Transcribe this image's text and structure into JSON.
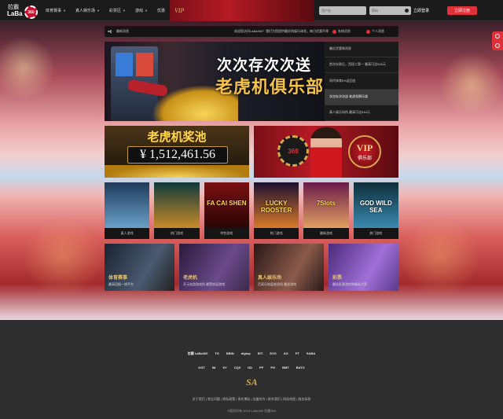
{
  "header": {
    "logo_text_top": "拉霸",
    "logo_text_bottom": "LaBa",
    "logo_badge": "360",
    "nav": [
      {
        "label": "体育赛事",
        "dropdown": true
      },
      {
        "label": "真人娱乐场",
        "dropdown": true
      },
      {
        "label": "彩票区",
        "dropdown": true
      },
      {
        "label": "游戏",
        "dropdown": true
      },
      {
        "label": "优惠",
        "dropdown": false
      }
    ],
    "vip_label": "VIP",
    "username_placeholder": "用户名",
    "password_placeholder": "密码",
    "login_label": "立即登录",
    "register_label": "立即注册"
  },
  "announcement": {
    "label": "最新消息",
    "text": "欢迎您访问LaBa360！我们为您提供最好的娱乐体验，每日优惠不停",
    "messages_label": "系统消息",
    "personal_label": "个人消息"
  },
  "hero": {
    "headline_1": "次次存次次送",
    "headline_2": "老虎机俱乐部"
  },
  "hero_menu": [
    {
      "label": "最近优惠和消息",
      "active": false
    },
    {
      "label": "首次存款后，西班二第一 最高可达518元",
      "active": false
    },
    {
      "label": "同代体育5%返回金",
      "active": false
    },
    {
      "label": "次次存次次送 老虎机俱乐部",
      "active": true
    },
    {
      "label": "真人娱乐场所 最高可达518元",
      "active": false
    }
  ],
  "promo": {
    "jackpot_title": "老虎机奖池",
    "jackpot_amount": "¥ 1,512,461.56",
    "vip_chip": "360",
    "vip_badge_top": "VIP",
    "vip_badge_bottom": "俱乐部"
  },
  "games": [
    {
      "label": "真人游戏",
      "art": ""
    },
    {
      "label": "热门游戏",
      "art": ""
    },
    {
      "label": "特色游戏",
      "art": "FA CAI SHEN"
    },
    {
      "label": "热门游戏",
      "art": "LUCKY ROOSTER"
    },
    {
      "label": "最新游戏",
      "art": "7Slots"
    },
    {
      "label": "热门游戏",
      "art": "GOD WILD SEA"
    }
  ],
  "cards": [
    {
      "title": "体育赛事",
      "subtitle": "最高回报一线平台"
    },
    {
      "title": "老虎机",
      "subtitle": "开元电游游戏机 最受欢迎游戏"
    },
    {
      "title": "真人娱乐场",
      "subtitle": "百家乐轮盘老虎机 最佳游戏"
    },
    {
      "title": "彩票",
      "subtitle": "最佳彩票游戏和精彩大奖"
    }
  ],
  "providers_row1": [
    "拉霸 LaBa360",
    "TG",
    "BBIN",
    "digtop",
    "BTI",
    "EVO",
    "AG",
    "PT",
    "SABA"
  ],
  "providers_row2": [
    "GGT",
    "IM",
    "SY",
    "CQ9",
    "GD",
    "PP",
    "PG",
    "BMT",
    "BATO"
  ],
  "providers_mark": "SA",
  "footer": {
    "links": "关于我们 | 常见问题 | 隐私政策 | 责任博彩 | 加盟合作 | 联系我们 | 网站地图 | 服务条款",
    "copyright": "©版权所有 2019 LaBa360 拉霸360"
  }
}
